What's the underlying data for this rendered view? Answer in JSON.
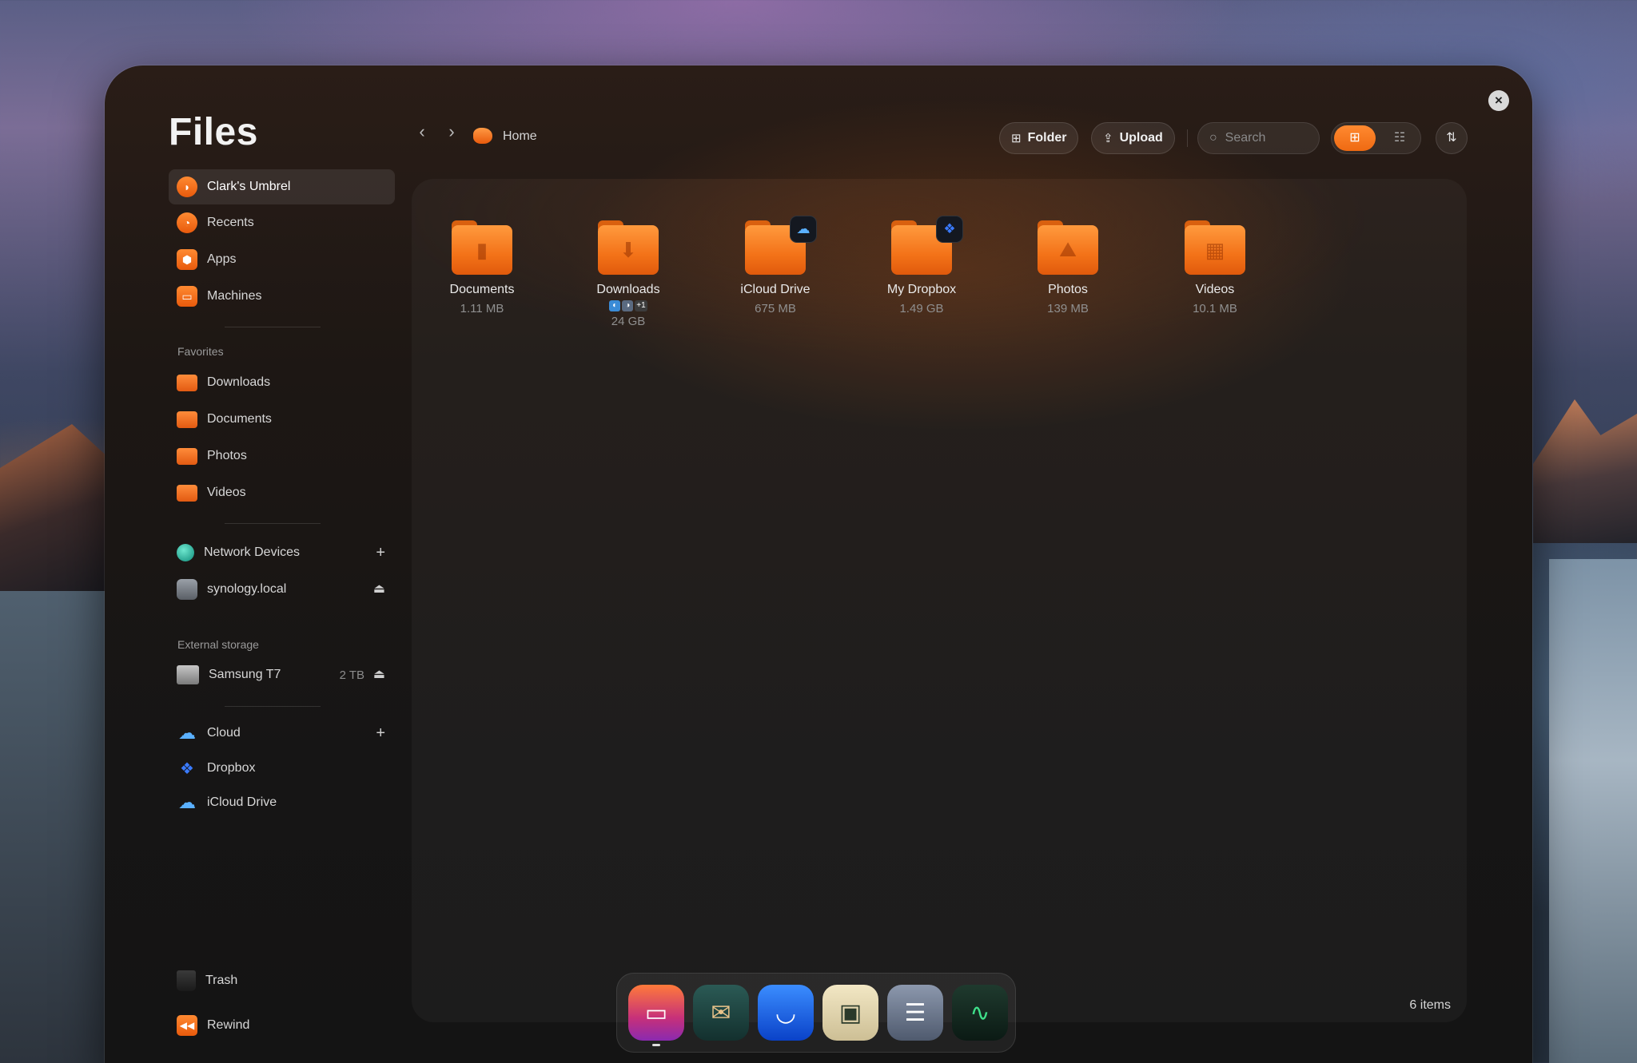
{
  "window": {
    "title": "Files"
  },
  "sidebar": {
    "main_items": [
      {
        "label": "Clark's Umbrel",
        "icon": "umbrel-icon",
        "active": true
      },
      {
        "label": "Recents",
        "icon": "clock-icon"
      },
      {
        "label": "Apps",
        "icon": "cube-icon"
      },
      {
        "label": "Machines",
        "icon": "monitor-icon"
      }
    ],
    "favorites_heading": "Favorites",
    "favorites": [
      {
        "label": "Downloads",
        "icon": "folder-icon"
      },
      {
        "label": "Documents",
        "icon": "folder-icon"
      },
      {
        "label": "Photos",
        "icon": "folder-icon"
      },
      {
        "label": "Videos",
        "icon": "folder-icon"
      }
    ],
    "network": {
      "label": "Network Devices",
      "action": "+"
    },
    "synology": {
      "label": "synology.local",
      "action": "⏏"
    },
    "external_heading": "External storage",
    "samsung": {
      "label": "Samsung T7",
      "size": "2 TB",
      "action": "⏏"
    },
    "cloud": {
      "label": "Cloud",
      "action": "+"
    },
    "dropbox": {
      "label": "Dropbox"
    },
    "icloud": {
      "label": "iCloud Drive"
    },
    "trash": {
      "label": "Trash"
    },
    "rewind": {
      "label": "Rewind"
    }
  },
  "toolbar": {
    "back": "‹",
    "forward": "›",
    "breadcrumb": "Home",
    "folder_label": "Folder",
    "upload_label": "Upload",
    "search_placeholder": "Search",
    "sort_icon": "⇅"
  },
  "files": [
    {
      "name": "Documents",
      "size": "1.11 MB",
      "glyph": "▮"
    },
    {
      "name": "Downloads",
      "size": "24 GB",
      "glyph": "⬇",
      "extra_badge": "+1"
    },
    {
      "name": "iCloud Drive",
      "size": "675 MB",
      "glyph": "",
      "badge": "☁"
    },
    {
      "name": "My Dropbox",
      "size": "1.49 GB",
      "glyph": "",
      "badge": "❖"
    },
    {
      "name": "Photos",
      "size": "139 MB",
      "glyph": "⛰"
    },
    {
      "name": "Videos",
      "size": "10.1 MB",
      "glyph": "▦"
    }
  ],
  "status": {
    "item_count": "6 items"
  },
  "dock": [
    {
      "name": "files-app",
      "glyph": "▭"
    },
    {
      "name": "photos-app",
      "glyph": "✉"
    },
    {
      "name": "mail-app",
      "glyph": "◡"
    },
    {
      "name": "display-app",
      "glyph": "▣"
    },
    {
      "name": "settings-app",
      "glyph": "☰"
    },
    {
      "name": "monitor-app",
      "glyph": "∿"
    }
  ],
  "colors": {
    "accent": "#f37218",
    "window_bg": "#161515"
  }
}
